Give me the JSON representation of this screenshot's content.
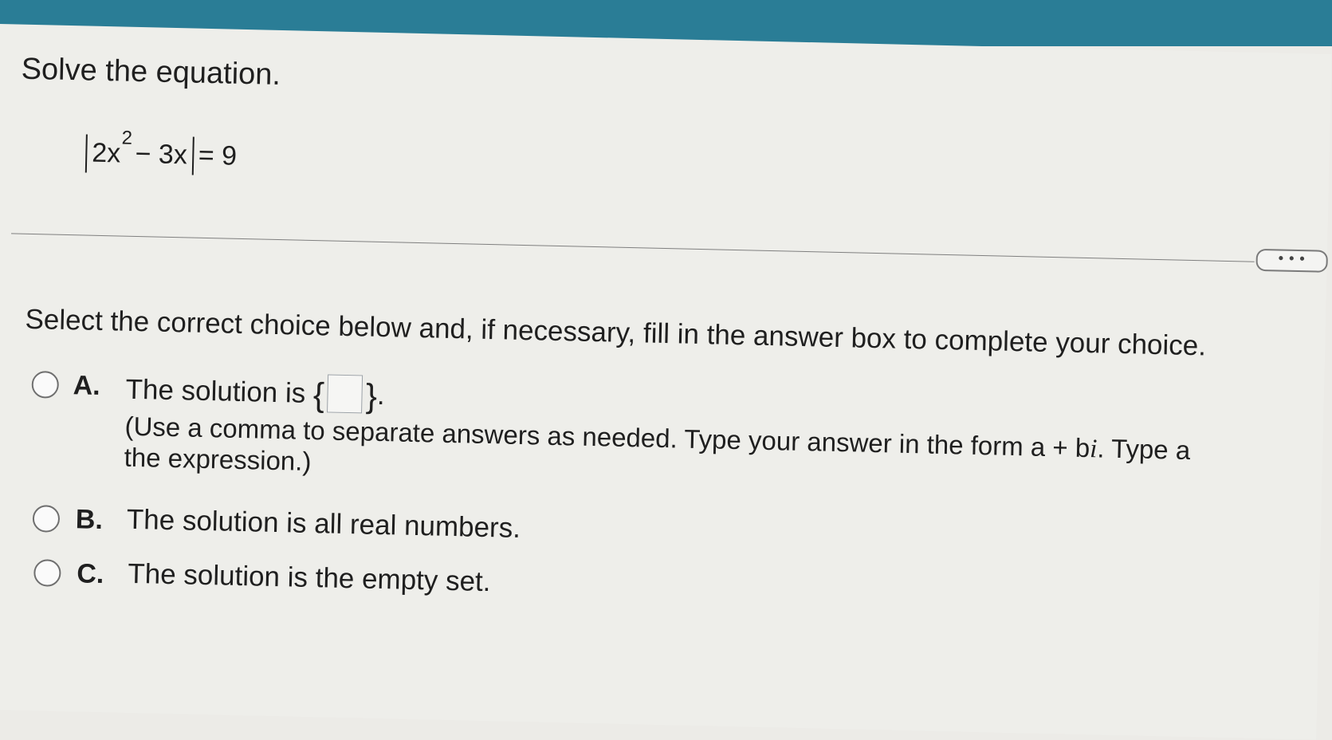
{
  "question": {
    "title": "Solve the equation.",
    "equation": {
      "left_term": "2x",
      "exponent": "2",
      "rest": " − 3x",
      "rhs": " = 9"
    }
  },
  "more_button": "• • •",
  "instruction": "Select the correct choice below and, if necessary, fill in the answer box to complete your choice.",
  "choices": [
    {
      "letter": "A.",
      "text_before": "The solution is ",
      "open_brace": "{",
      "answer_value": "",
      "close_brace": "}",
      "text_after": ".",
      "hint_line1_a": "(Use a comma to separate answers as needed. Type your answer in the form a + b",
      "hint_i": "i",
      "hint_line1_b": ". Type a",
      "hint_line2": "the expression.)"
    },
    {
      "letter": "B.",
      "text": "The solution is all real numbers."
    },
    {
      "letter": "C.",
      "text": "The solution is the empty set."
    }
  ]
}
